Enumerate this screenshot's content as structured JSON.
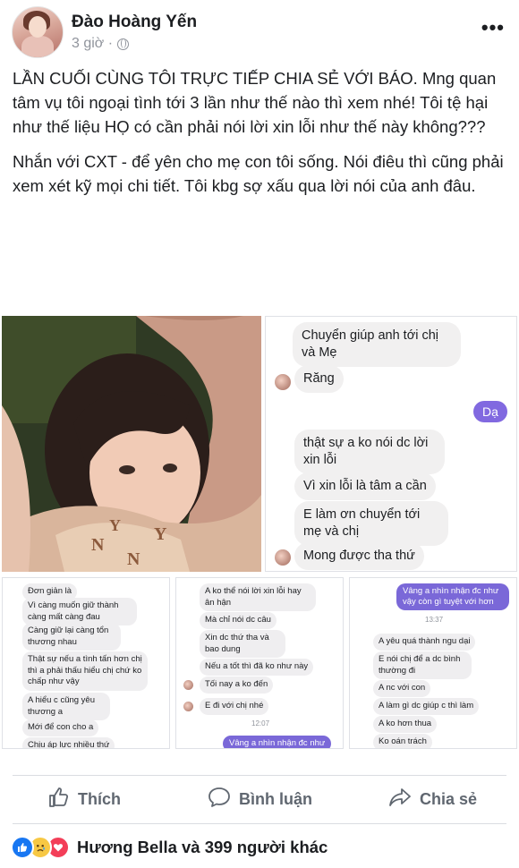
{
  "post": {
    "author": "Đào Hoàng Yến",
    "time": "3 giờ ·",
    "more_label": "•••",
    "paragraph1": "LẦN CUỐI CÙNG TÔI TRỰC TIẾP CHIA SẺ VỚI BÁO. Mng quan tâm vụ tôi ngoại tình tới 3 lần như thế nào thì xem nhé! Tôi tệ hại như thế liệu HỌ có cần phải nói lời xin lỗi như thế này không???",
    "paragraph2": "Nhắn với CXT - để yên cho mẹ con tôi sống. Nói điêu thì cũng phải xem xét kỹ mọi chi tiết. Tôi kbg sợ xấu qua lời nói của anh đâu."
  },
  "chat_main": {
    "messages": [
      {
        "text": "Chuyển giúp anh tới chị và Mẹ"
      },
      {
        "text": "Răng"
      },
      {
        "text": "Dạ",
        "outgoing": true
      },
      {
        "text": "thật sự a ko nói dc lời xin lỗi"
      },
      {
        "text": "Vì xin lỗi là tâm a cần"
      },
      {
        "text": "E làm ơn chuyển tới mẹ và chị"
      },
      {
        "text": "Mong được tha thứ"
      }
    ]
  },
  "chat_strip1": {
    "messages": [
      "Đơn giản là",
      "Vì càng muốn giữ thành càng mất càng đau",
      "Càng giữ lại càng tổn thương nhau",
      "Thật sự nếu a tình tấn hơn chị thì a phải thấu hiểu chị chứ ko chấp như vậy",
      "A hiểu c cũng yêu thương a",
      "Mới để con cho a",
      "Chịu áp lực nhiều thứ"
    ]
  },
  "chat_strip2": {
    "messages": [
      "A ko thể nói lời xin lỗi hay ân hận",
      "Mà chỉ nói dc câu",
      "Xin dc thứ tha và bao dung",
      "Nếu a tốt thì đã ko như này",
      "Tối nay a ko đến",
      "E đi với chị nhé"
    ],
    "time": "12:07",
    "outgoing": "Vâng a nhìn nhận đc như"
  },
  "chat_strip3": {
    "outgoing": "Vâng a nhìn nhận đc như vậy còn gì tuyệt với hơn",
    "time": "13:37",
    "messages": [
      "A yêu quá thành ngu dại",
      "E nói chị để a dc bình thường đi",
      "A nc với con",
      "A làm gì dc giúp c thì làm",
      "A ko hơn thua",
      "Ko oán trách"
    ]
  },
  "actions": {
    "like": "Thích",
    "comment": "Bình luận",
    "share": "Chia sẻ"
  },
  "reactions": {
    "icons": [
      "like-icon",
      "sad-icon",
      "love-icon"
    ],
    "summary": "Hương Bella và 399 người khác"
  },
  "colors": {
    "facebook_blue": "#1877f2",
    "messenger_purple": "#8169e0",
    "gray_text": "#606770"
  }
}
